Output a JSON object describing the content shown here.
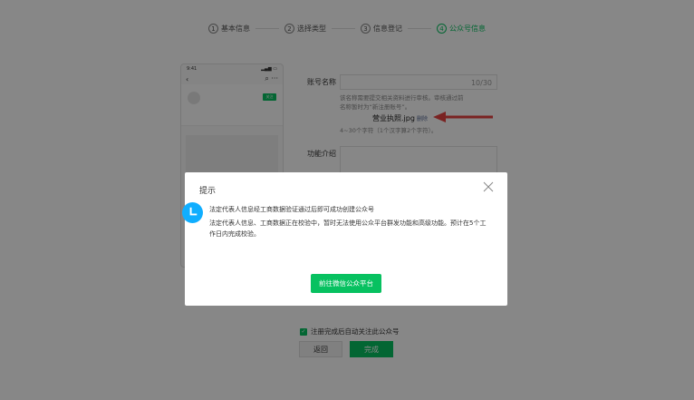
{
  "steps": [
    {
      "num": "1",
      "label": "基本信息"
    },
    {
      "num": "2",
      "label": "选择类型"
    },
    {
      "num": "3",
      "label": "信息登记"
    },
    {
      "num": "4",
      "label": "公众号信息"
    }
  ],
  "phone": {
    "time": "9:41",
    "back_glyph": "‹",
    "search_glyph": "⌕",
    "more_glyph": "···",
    "follow_label": "关注"
  },
  "form": {
    "account_name_label": "账号名称",
    "account_name_counter": "10/30",
    "hint_line1": "该名称需要提交相关资料进行审核。审核通过前",
    "hint_line2": "名称暂时为“新注册账号”。",
    "file_name": "营业执照.jpg",
    "delete_label": "删除",
    "length_hint": "4~30个字符（1个汉字算2个字符）。",
    "intro_label": "功能介绍"
  },
  "bottom": {
    "agree_text": "注册完成后自动关注此公众号",
    "back_label": "返回",
    "done_label": "完成"
  },
  "dialog": {
    "title": "提示",
    "message_title": "法定代表人信息经工商数据验证通过后即可成功创建公众号",
    "message_body": "法定代表人信息、工商数据正在校验中，暂时无法使用公众平台群发功能和高级功能。预计在5个工作日内完成校验。",
    "button_label": "前往微信公众平台"
  },
  "colors": {
    "accent": "#07c160",
    "info_icon": "#10aeff",
    "annotation_arrow": "#e64340"
  }
}
